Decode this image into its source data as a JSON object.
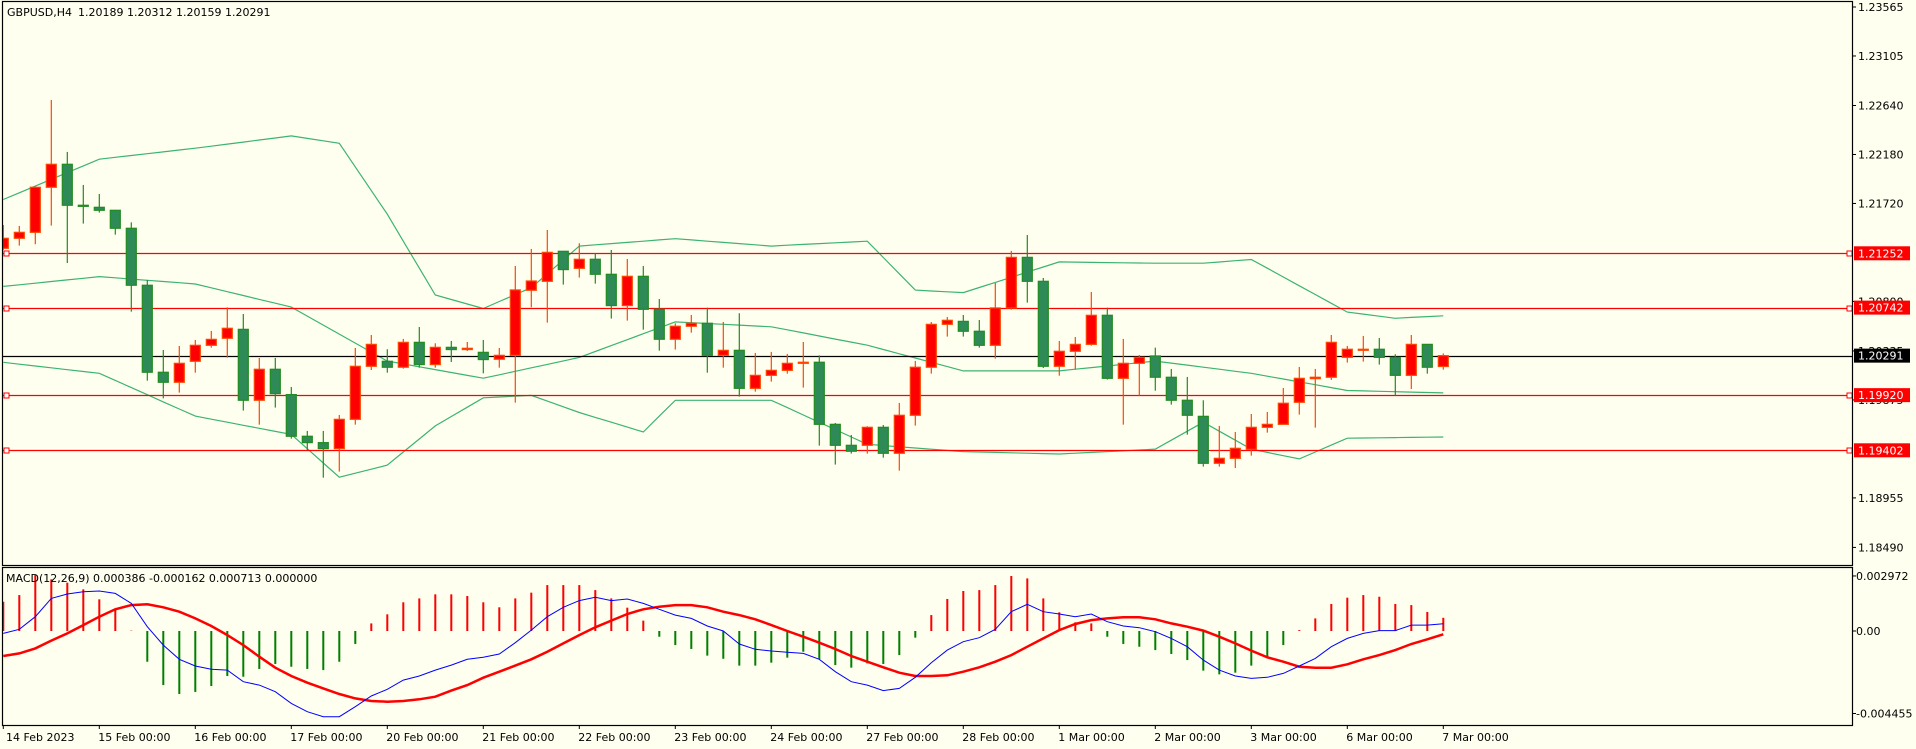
{
  "header": {
    "symbol": "GBPUSD,H4",
    "ohlc": "1.20189 1.20312 1.20159 1.20291"
  },
  "macd_header": {
    "label": "MACD(12,26,9)",
    "values": "0.000386 -0.000162 0.000713 0.000000"
  },
  "colors": {
    "background": "#fffff0",
    "bull_body": "#ff0000",
    "bull_border": "#ff4500",
    "bear_body": "#2e8b57",
    "bear_border": "#228b22",
    "bands": "#3cb371",
    "macd_main": "#0000ff",
    "macd_signal": "#ff0000",
    "hist_pos": "#ff0000",
    "hist_neg": "#008000",
    "level": "#ff0000",
    "bid": "#000000"
  },
  "price_axis": {
    "ticks": [
      {
        "value": 1.23565,
        "label": "1.23565"
      },
      {
        "value": 1.23105,
        "label": "1.23105"
      },
      {
        "value": 1.2264,
        "label": "1.22640"
      },
      {
        "value": 1.2218,
        "label": "1.22180"
      },
      {
        "value": 1.2172,
        "label": "1.21720"
      },
      {
        "value": 1.208,
        "label": "1.20800"
      },
      {
        "value": 1.20335,
        "label": "1.20335"
      },
      {
        "value": 1.19875,
        "label": "1.19875"
      },
      {
        "value": 1.18955,
        "label": "1.18955"
      },
      {
        "value": 1.1849,
        "label": "1.18490"
      }
    ]
  },
  "levels": [
    {
      "price": 1.21252,
      "label": "1.21252"
    },
    {
      "price": 1.20742,
      "label": "1.20742"
    },
    {
      "price": 1.1992,
      "label": "1.19920"
    },
    {
      "price": 1.19402,
      "label": "1.19402"
    }
  ],
  "bid": {
    "price": 1.20291,
    "label": "1.20291"
  },
  "macd_axis": {
    "ticks": [
      {
        "value": 0.002972,
        "label": "0.002972"
      },
      {
        "value": 0,
        "label": "0.00"
      },
      {
        "value": -0.004455,
        "label": "-0.004455"
      }
    ]
  },
  "time_axis": {
    "labels": [
      {
        "bar": 0,
        "label": "14 Feb 2023"
      },
      {
        "bar": 6,
        "label": "15 Feb 00:00"
      },
      {
        "bar": 12,
        "label": "16 Feb 00:00"
      },
      {
        "bar": 18,
        "label": "17 Feb 00:00"
      },
      {
        "bar": 24,
        "label": "20 Feb 00:00"
      },
      {
        "bar": 30,
        "label": "21 Feb 00:00"
      },
      {
        "bar": 36,
        "label": "22 Feb 00:00"
      },
      {
        "bar": 42,
        "label": "23 Feb 00:00"
      },
      {
        "bar": 48,
        "label": "24 Feb 00:00"
      },
      {
        "bar": 54,
        "label": "27 Feb 00:00"
      },
      {
        "bar": 60,
        "label": "28 Feb 00:00"
      },
      {
        "bar": 66,
        "label": "1 Mar 00:00"
      },
      {
        "bar": 72,
        "label": "2 Mar 00:00"
      },
      {
        "bar": 78,
        "label": "3 Mar 00:00"
      },
      {
        "bar": 84,
        "label": "6 Mar 00:00"
      },
      {
        "bar": 90,
        "label": "7 Mar 00:00"
      }
    ]
  },
  "chart_data": {
    "type": "candlestick",
    "title": "GBPUSD,H4",
    "ylim": [
      1.1849,
      1.23565
    ],
    "candles_ohlc": [
      [
        1.21299,
        1.21518,
        1.21283,
        1.21393
      ],
      [
        1.21393,
        1.21509,
        1.21324,
        1.21449
      ],
      [
        1.21449,
        1.21878,
        1.21337,
        1.21872
      ],
      [
        1.21872,
        1.22692,
        1.21512,
        1.22088
      ],
      [
        1.22088,
        1.22204,
        1.21161,
        1.21703
      ],
      [
        1.21703,
        1.21894,
        1.21531,
        1.21693
      ],
      [
        1.21684,
        1.21809,
        1.21634,
        1.21656
      ],
      [
        1.21656,
        1.21656,
        1.21427,
        1.21487
      ],
      [
        1.21487,
        1.21543,
        1.20704,
        1.20952
      ],
      [
        1.20952,
        1.21002,
        1.20056,
        1.20135
      ],
      [
        1.20135,
        1.20344,
        1.1989,
        1.20041
      ],
      [
        1.20041,
        1.20382,
        1.19944,
        1.20219
      ],
      [
        1.20238,
        1.20438,
        1.20131,
        1.20388
      ],
      [
        1.20388,
        1.20523,
        1.20366,
        1.20444
      ],
      [
        1.20454,
        1.20745,
        1.20272,
        1.20548
      ],
      [
        1.20538,
        1.20682,
        1.19775,
        1.19872
      ],
      [
        1.19872,
        1.20269,
        1.19643,
        1.20163
      ],
      [
        1.20163,
        1.20269,
        1.19803,
        1.19934
      ],
      [
        1.19925,
        1.19997,
        1.19512,
        1.19534
      ],
      [
        1.19534,
        1.19584,
        1.19405,
        1.19474
      ],
      [
        1.19474,
        1.19584,
        1.19145,
        1.19418
      ],
      [
        1.19418,
        1.19734,
        1.19202,
        1.19693
      ],
      [
        1.19693,
        1.20363,
        1.19643,
        1.20191
      ],
      [
        1.20191,
        1.20485,
        1.20156,
        1.20397
      ],
      [
        1.20238,
        1.20351,
        1.20131,
        1.20182
      ],
      [
        1.20182,
        1.20448,
        1.20169,
        1.20416
      ],
      [
        1.20416,
        1.2056,
        1.20178,
        1.20207
      ],
      [
        1.20207,
        1.20407,
        1.20178,
        1.20369
      ],
      [
        1.20369,
        1.20429,
        1.20232,
        1.20348
      ],
      [
        1.20348,
        1.20419,
        1.20335,
        1.2036
      ],
      [
        1.20322,
        1.20438,
        1.20125,
        1.20254
      ],
      [
        1.20257,
        1.20363,
        1.20178,
        1.20294
      ],
      [
        1.20294,
        1.21133,
        1.1985,
        1.20908
      ],
      [
        1.20905,
        1.21293,
        1.20745,
        1.20992
      ],
      [
        1.20989,
        1.21471,
        1.20601,
        1.21261
      ],
      [
        1.21271,
        1.21271,
        1.20958,
        1.21099
      ],
      [
        1.21111,
        1.21346,
        1.21024,
        1.21196
      ],
      [
        1.21196,
        1.21252,
        1.20967,
        1.21055
      ],
      [
        1.21055,
        1.21283,
        1.20639,
        1.20761
      ],
      [
        1.20761,
        1.21199,
        1.2062,
        1.21036
      ],
      [
        1.21036,
        1.21133,
        1.20535,
        1.20726
      ],
      [
        1.20726,
        1.20823,
        1.20338,
        1.20445
      ],
      [
        1.20445,
        1.20595,
        1.20348,
        1.20567
      ],
      [
        1.20567,
        1.20673,
        1.20507,
        1.20595
      ],
      [
        1.20595,
        1.20742,
        1.20131,
        1.20294
      ],
      [
        1.20294,
        1.20607,
        1.20178,
        1.20341
      ],
      [
        1.20341,
        1.20689,
        1.19906,
        1.19984
      ],
      [
        1.19984,
        1.20316,
        1.19953,
        1.20106
      ],
      [
        1.20106,
        1.20326,
        1.20047,
        1.20153
      ],
      [
        1.20153,
        1.20307,
        1.20122,
        1.20219
      ],
      [
        1.20219,
        1.20419,
        1.19991,
        1.20229
      ],
      [
        1.20229,
        1.20294,
        1.19446,
        1.19646
      ],
      [
        1.19646,
        1.19659,
        1.19268,
        1.19449
      ],
      [
        1.19449,
        1.19546,
        1.19371,
        1.19393
      ],
      [
        1.19449,
        1.19628,
        1.19371,
        1.19618
      ],
      [
        1.19618,
        1.1964,
        1.19333,
        1.19374
      ],
      [
        1.19374,
        1.19847,
        1.19211,
        1.19731
      ],
      [
        1.19731,
        1.20241,
        1.19634,
        1.20182
      ],
      [
        1.20182,
        1.20607,
        1.20122,
        1.20585
      ],
      [
        1.20585,
        1.20654,
        1.2047,
        1.20623
      ],
      [
        1.20613,
        1.20673,
        1.2047,
        1.2052
      ],
      [
        1.2052,
        1.20626,
        1.20366,
        1.20388
      ],
      [
        1.20388,
        1.20973,
        1.20263,
        1.20739
      ],
      [
        1.20739,
        1.21274,
        1.20723,
        1.21214
      ],
      [
        1.21214,
        1.21424,
        1.20789,
        1.20989
      ],
      [
        1.20989,
        1.2102,
        1.20175,
        1.20191
      ],
      [
        1.20191,
        1.20429,
        1.20103,
        1.20332
      ],
      [
        1.20332,
        1.20466,
        1.2016,
        1.20397
      ],
      [
        1.20397,
        1.20889,
        1.20385,
        1.2067
      ],
      [
        1.2067,
        1.20742,
        1.20066,
        1.20078
      ],
      [
        1.20078,
        1.20448,
        1.19643,
        1.20219
      ],
      [
        1.20219,
        1.20297,
        1.19915,
        1.20275
      ],
      [
        1.20288,
        1.20366,
        1.19962,
        1.20088
      ],
      [
        1.20088,
        1.20166,
        1.19831,
        1.19872
      ],
      [
        1.19872,
        1.20091,
        1.19549,
        1.19731
      ],
      [
        1.19721,
        1.19872,
        1.19249,
        1.1928
      ],
      [
        1.1928,
        1.19631,
        1.19249,
        1.19327
      ],
      [
        1.19327,
        1.19574,
        1.19236,
        1.19421
      ],
      [
        1.19412,
        1.19743,
        1.19352,
        1.19618
      ],
      [
        1.19618,
        1.19762,
        1.19568,
        1.19646
      ],
      [
        1.19646,
        1.19987,
        1.19646,
        1.19844
      ],
      [
        1.19853,
        1.20185,
        1.19737,
        1.20078
      ],
      [
        1.20075,
        1.20166,
        1.19615,
        1.20088
      ],
      [
        1.20088,
        1.20485,
        1.20063,
        1.20416
      ],
      [
        1.20275,
        1.20382,
        1.20226,
        1.20351
      ],
      [
        1.20341,
        1.20476,
        1.20235,
        1.20351
      ],
      [
        1.20351,
        1.20457,
        1.20207,
        1.20275
      ],
      [
        1.20275,
        1.20304,
        1.19915,
        1.20106
      ],
      [
        1.20106,
        1.20485,
        1.19978,
        1.20397
      ],
      [
        1.20397,
        1.20397,
        1.20122,
        1.20182
      ],
      [
        1.20189,
        1.20312,
        1.20159,
        1.20291
      ]
    ],
    "bollinger": {
      "upper": [
        [
          0,
          1.21757
        ],
        [
          6,
          1.22136
        ],
        [
          12,
          1.22239
        ],
        [
          18,
          1.22354
        ],
        [
          21,
          1.22285
        ],
        [
          24,
          1.21619
        ],
        [
          27,
          1.2086
        ],
        [
          30,
          1.20734
        ],
        [
          33,
          1.20929
        ],
        [
          36,
          1.2132
        ],
        [
          42,
          1.21389
        ],
        [
          48,
          1.2132
        ],
        [
          54,
          1.21366
        ],
        [
          57,
          1.20906
        ],
        [
          60,
          1.20883
        ],
        [
          66,
          1.21171
        ],
        [
          72,
          1.21159
        ],
        [
          75,
          1.21159
        ],
        [
          78,
          1.21194
        ],
        [
          84,
          1.207
        ],
        [
          87,
          1.20642
        ],
        [
          90,
          1.20665
        ]
      ],
      "middle": [
        [
          0,
          1.20941
        ],
        [
          6,
          1.21033
        ],
        [
          12,
          1.20964
        ],
        [
          18,
          1.20747
        ],
        [
          24,
          1.2024
        ],
        [
          30,
          1.20079
        ],
        [
          36,
          1.20274
        ],
        [
          42,
          1.20608
        ],
        [
          48,
          1.20562
        ],
        [
          54,
          1.20389
        ],
        [
          60,
          1.20148
        ],
        [
          66,
          1.20148
        ],
        [
          72,
          1.2024
        ],
        [
          78,
          1.20125
        ],
        [
          84,
          1.19964
        ],
        [
          90,
          1.19941
        ]
      ],
      "lower": [
        [
          0,
          1.20228
        ],
        [
          6,
          1.20125
        ],
        [
          12,
          1.19723
        ],
        [
          18,
          1.19551
        ],
        [
          21,
          1.19149
        ],
        [
          24,
          1.19263
        ],
        [
          27,
          1.19631
        ],
        [
          30,
          1.19895
        ],
        [
          33,
          1.19918
        ],
        [
          36,
          1.19757
        ],
        [
          40,
          1.19574
        ],
        [
          42,
          1.19872
        ],
        [
          48,
          1.19872
        ],
        [
          54,
          1.19458
        ],
        [
          60,
          1.1939
        ],
        [
          66,
          1.19367
        ],
        [
          72,
          1.19413
        ],
        [
          75,
          1.19666
        ],
        [
          78,
          1.19413
        ],
        [
          81,
          1.19321
        ],
        [
          84,
          1.19516
        ],
        [
          90,
          1.19527
        ]
      ]
    },
    "macd": {
      "main": [
        -0.00013,
        9e-05,
        0.00077,
        0.00176,
        0.002,
        0.00212,
        0.00216,
        0.00203,
        0.00149,
        0.00023,
        -0.00076,
        -0.00153,
        -0.00189,
        -0.00207,
        -0.00211,
        -0.00274,
        -0.00292,
        -0.00328,
        -0.00391,
        -0.00436,
        -0.00463,
        -0.00463,
        -0.00409,
        -0.00351,
        -0.00315,
        -0.00265,
        -0.00243,
        -0.00211,
        -0.00184,
        -0.00153,
        -0.00142,
        -0.00124,
        -0.00063,
        5e-05,
        0.00077,
        0.00128,
        0.00164,
        0.00182,
        0.00164,
        0.00173,
        0.00149,
        0.00117,
        0.00086,
        0.00068,
        0.00027,
        0.0,
        -0.0007,
        -0.00099,
        -0.00108,
        -0.00115,
        -0.00121,
        -0.00153,
        -0.0022,
        -0.00274,
        -0.00292,
        -0.00322,
        -0.0031,
        -0.0025,
        -0.00171,
        -0.00103,
        -0.00058,
        -0.00036,
        9e-05,
        0.00104,
        0.00144,
        0.00104,
        0.00092,
        0.00077,
        0.00092,
        0.0005,
        0.00027,
        0.00018,
        -4e-05,
        -0.0004,
        -0.00085,
        -0.00157,
        -0.00211,
        -0.00243,
        -0.00256,
        -0.0025,
        -0.00229,
        -0.00189,
        -0.00148,
        -0.00085,
        -0.0004,
        -0.00013,
        2e-05,
        2e-05,
        0.00032,
        0.00032,
        0.00039
      ],
      "signal": [
        -0.00135,
        -0.00121,
        -0.00094,
        -0.00052,
        -0.00013,
        0.00032,
        0.00077,
        0.00117,
        0.0014,
        0.00144,
        0.00128,
        0.00104,
        0.00068,
        0.00027,
        -0.00022,
        -0.00076,
        -0.00139,
        -0.00198,
        -0.00243,
        -0.00279,
        -0.0031,
        -0.0034,
        -0.00364,
        -0.00378,
        -0.00382,
        -0.00378,
        -0.00369,
        -0.00355,
        -0.00322,
        -0.00292,
        -0.00252,
        -0.0022,
        -0.00187,
        -0.00153,
        -0.00112,
        -0.00067,
        -0.00022,
        0.0002,
        0.00056,
        0.00092,
        0.00117,
        0.00131,
        0.0014,
        0.0014,
        0.00128,
        0.00104,
        0.00086,
        0.00063,
        0.00032,
        0.0,
        -0.00031,
        -0.00063,
        -0.00097,
        -0.00135,
        -0.00166,
        -0.00196,
        -0.00225,
        -0.00243,
        -0.00243,
        -0.00239,
        -0.0022,
        -0.00196,
        -0.00166,
        -0.0013,
        -0.00085,
        -0.0004,
        5e-05,
        0.00038,
        0.00059,
        0.00068,
        0.00074,
        0.00074,
        0.00063,
        0.00041,
        0.00023,
        2e-05,
        -0.00031,
        -0.00067,
        -0.00106,
        -0.00142,
        -0.00166,
        -0.00193,
        -0.00198,
        -0.00198,
        -0.0018,
        -0.00153,
        -0.0013,
        -0.00103,
        -0.0007,
        -0.00045,
        -0.00018
      ],
      "histogram": [
        0.00158,
        0.00194,
        0.00302,
        0.00279,
        0.00261,
        0.00225,
        0.00171,
        0.00113,
        2e-05,
        -0.00166,
        -0.00292,
        -0.0034,
        -0.00329,
        -0.00297,
        -0.00243,
        -0.00247,
        -0.00205,
        -0.00178,
        -0.00193,
        -0.00205,
        -0.00211,
        -0.00166,
        -0.0007,
        0.00041,
        0.0009,
        0.00155,
        0.00176,
        0.00198,
        0.00198,
        0.00189,
        0.00155,
        0.00128,
        0.00176,
        0.00207,
        0.00248,
        0.00248,
        0.00248,
        0.00221,
        0.00176,
        0.00126,
        0.00056,
        -0.00031,
        -0.00076,
        -0.00097,
        -0.00133,
        -0.0015,
        -0.00187,
        -0.00187,
        -0.00171,
        -0.00144,
        -0.00112,
        -0.00151,
        -0.00184,
        -0.00198,
        -0.00175,
        -0.00178,
        -0.0013,
        -0.00036,
        0.00086,
        0.00173,
        0.00216,
        0.00221,
        0.00248,
        0.00297,
        0.00284,
        0.00176,
        0.00101,
        0.00047,
        0.00041,
        -0.00031,
        -0.0007,
        -0.00085,
        -0.00103,
        -0.00124,
        -0.00157,
        -0.00214,
        -0.00234,
        -0.00225,
        -0.00187,
        -0.00142,
        -0.00076,
        5e-05,
        0.00068,
        0.00146,
        0.0018,
        0.00194,
        0.00185,
        0.00146,
        0.0014,
        0.00103,
        0.000713
      ]
    }
  }
}
